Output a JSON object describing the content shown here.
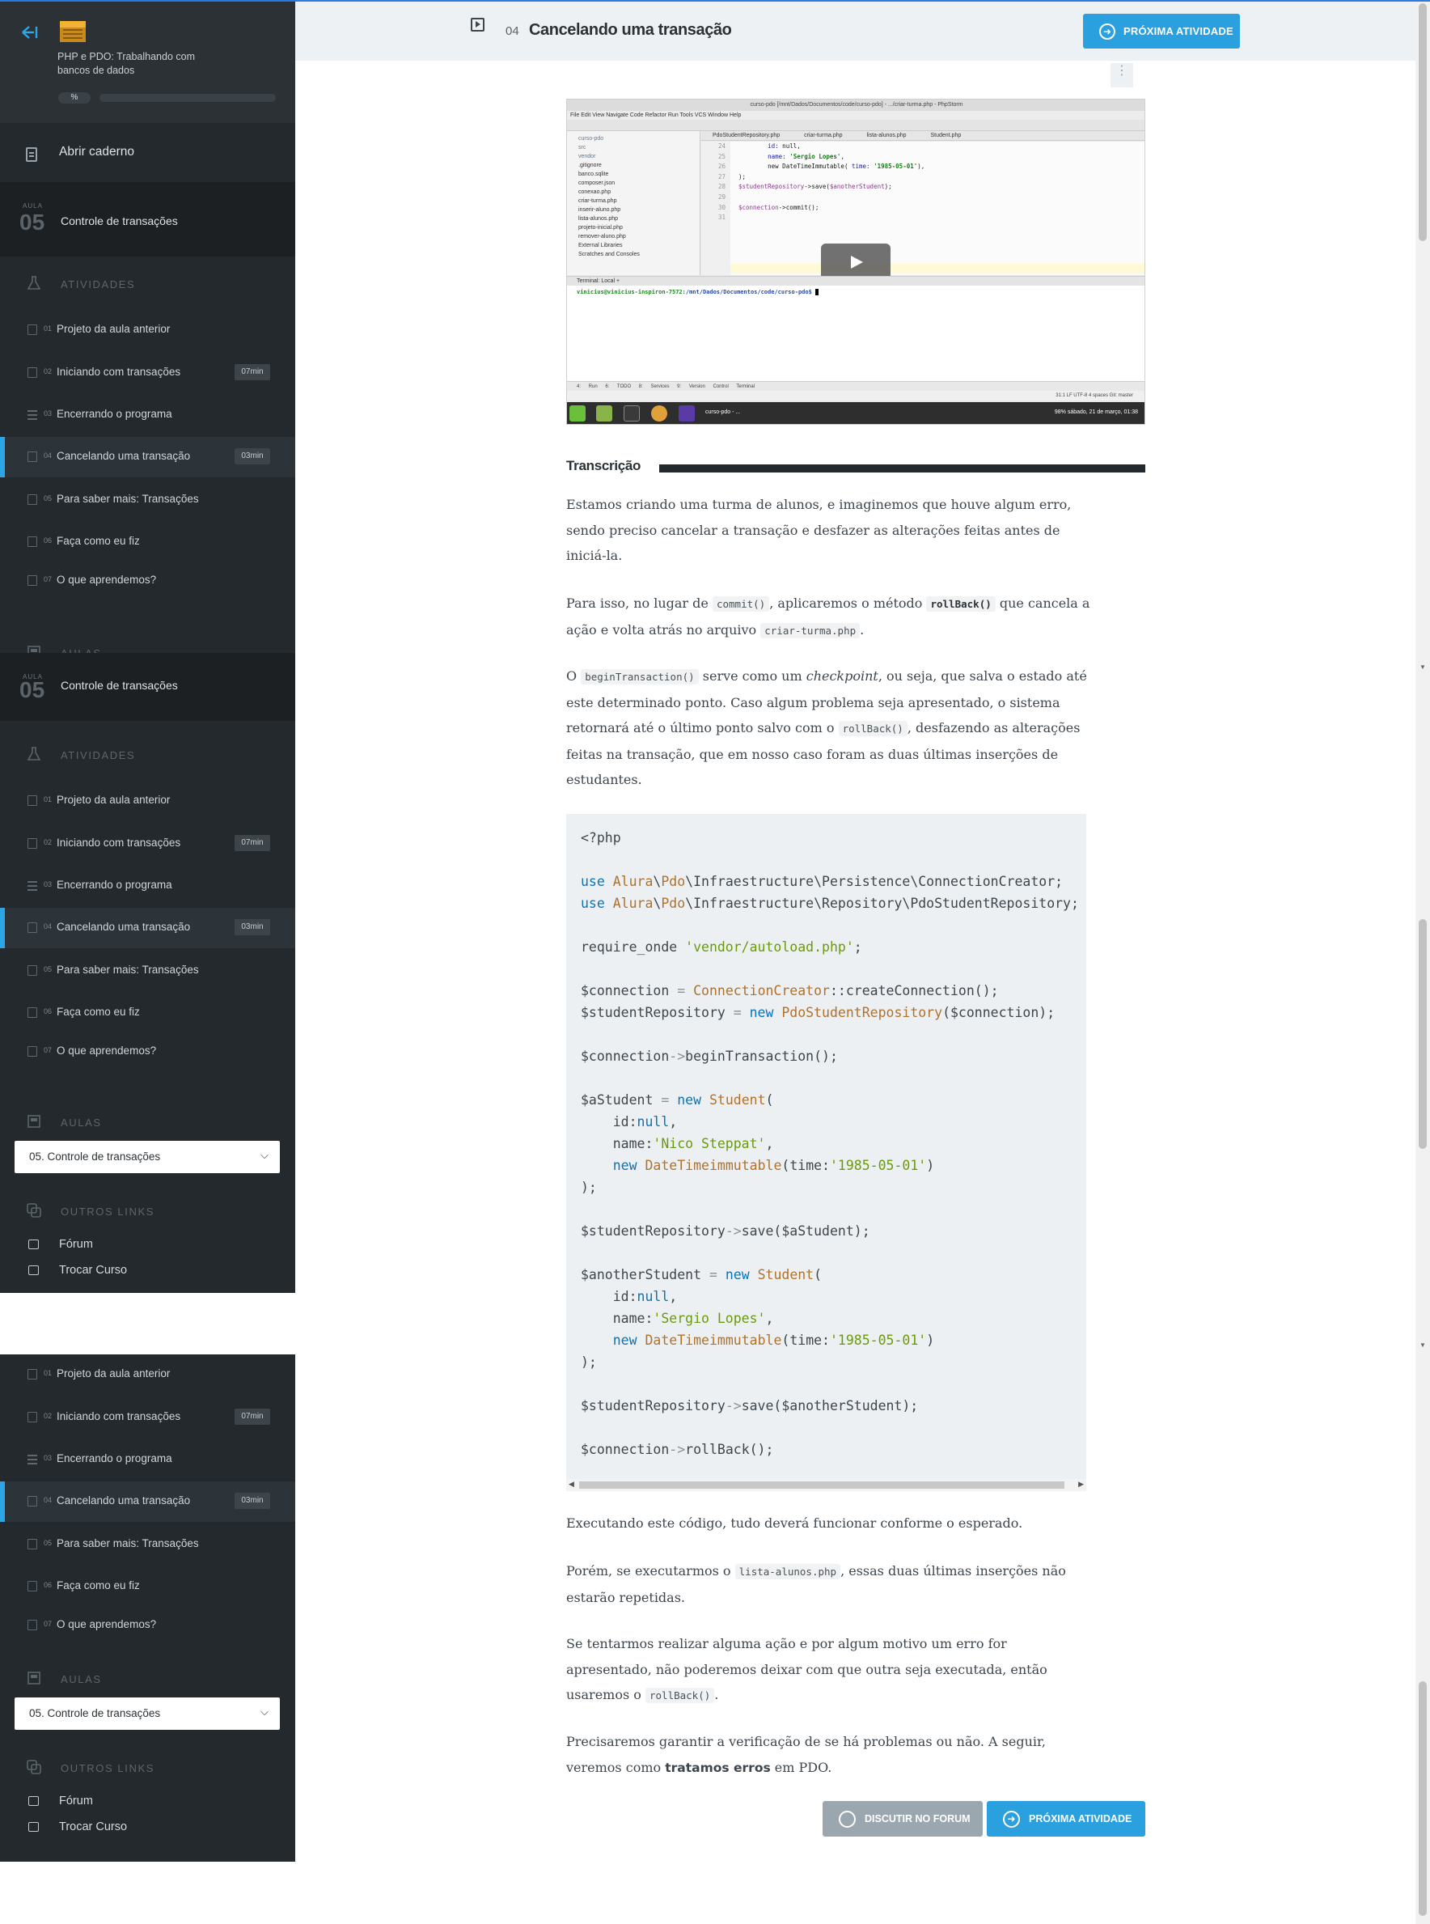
{
  "course": {
    "title": "PHP e PDO: Trabalhando com bancos de dados",
    "progress_label": "%",
    "progress_fraction": 0.0
  },
  "sidebar": {
    "notebook_label": "Abrir caderno",
    "lesson": {
      "aula_label": "AULA",
      "number": "05",
      "title": "Controle de transações"
    },
    "activities_heading": "ATIVIDADES",
    "activities": [
      {
        "num": "01",
        "title": "Projeto da aula anterior",
        "icon": "book-icon",
        "badge": ""
      },
      {
        "num": "02",
        "title": "Iniciando com transações",
        "icon": "video-icon",
        "badge": "07min"
      },
      {
        "num": "03",
        "title": "Encerrando o programa",
        "icon": "list-icon",
        "badge": ""
      },
      {
        "num": "04",
        "title": "Cancelando uma transação",
        "icon": "video-icon",
        "badge": "03min",
        "active": true
      },
      {
        "num": "05",
        "title": "Para saber mais: Transações",
        "icon": "book-icon",
        "badge": ""
      },
      {
        "num": "06",
        "title": "Faça como eu fiz",
        "icon": "book-icon",
        "badge": ""
      },
      {
        "num": "07",
        "title": "O que aprendemos?",
        "icon": "book-icon",
        "badge": ""
      }
    ],
    "aulas_heading": "AULAS",
    "aulas_selected": "05. Controle de transações",
    "outros_heading": "OUTROS LINKS",
    "links": [
      {
        "label": "Fórum",
        "icon": "forum-icon"
      },
      {
        "label": "Trocar Curso",
        "icon": "switch-course-icon"
      }
    ]
  },
  "topbar": {
    "activity_num": "04",
    "activity_title": "Cancelando uma transação",
    "next_label": "PRÓXIMA ATIVIDADE"
  },
  "video": {
    "window_title": "curso-pdo [/mnt/Dados/Documentos/code/curso-pdo] - .../criar-turma.php - PhpStorm",
    "menu": "File  Edit  View  Navigate  Code  Refactor  Run  Tools  VCS  Window  Help",
    "tabs": "PdoStudentRepository.php criar-turma.php lista-alunos.php Student.php",
    "tree": [
      "curso-pdo",
      "src",
      "vendor",
      ".gitignore",
      "banco.sqlite",
      "composer.json",
      "conexao.php",
      "criar-turma.php",
      "inserir-aluno.php",
      "lista-alunos.php",
      "projeto-inicial.php",
      "remover-aluno.php",
      "External Libraries",
      "Scratches and Consoles"
    ],
    "gutter": [
      "24",
      "25",
      "26",
      "27",
      "28",
      "29",
      "30",
      "31"
    ],
    "terminal_header": "Terminal:   Local   +",
    "terminal_user": "vinicius@vinicius-inspiron-7572",
    "terminal_path": ":/mnt/Dados/Documentos/code/curso-pdo$",
    "statusbar": "4: Run   6: TODO   8: Services   9: Version Control   Terminal",
    "status2": "31:1   LF   UTF-8   4 spaces   Git: master",
    "taskbar_label": "curso-pdo - ...",
    "clock": "98%  sábado, 21 de março, 01:38"
  },
  "transcript": {
    "heading": "Transcrição"
  },
  "paragraphs": {
    "p1": "Estamos criando uma turma de alunos, e imaginemos que houve algum erro, sendo preciso cancelar a transação e desfazer as alterações feitas antes de iniciá-la.",
    "p2a": "Para isso, no lugar de ",
    "p2_code1": "commit()",
    "p2b": ", aplicaremos o método ",
    "p2_code2": "rollBack()",
    "p2c": " que cancela a ação e volta atrás no arquivo ",
    "p2_code3": "criar-turma.php",
    "p2d": ".",
    "p3a": "O ",
    "p3_code1": "beginTransaction()",
    "p3b": " serve como um ",
    "p3_em": "checkpoint",
    "p3c": ", ou seja, que salva o estado até este determinado ponto. Caso algum problema seja apresentado, o sistema retornará até o último ponto salvo com o ",
    "p3_code2": "rollBack()",
    "p3d": ", desfazendo as alterações feitas na transação, que em nosso caso foram as duas últimas inserções de estudantes.",
    "p4": "Executando este código, tudo deverá funcionar conforme o esperado.",
    "p5a": "Porém, se executarmos o ",
    "p5_code": "lista-alunos.php",
    "p5b": ", essas duas últimas inserções não estarão repetidas.",
    "p6a": "Se tentarmos realizar alguma ação e por algum motivo um erro for apresentado, não poderemos deixar com que outra seja executada, então usaremos o ",
    "p6_code": "rollBack()",
    "p6b": ".",
    "p7a": "Precisaremos garantir a verificação de se há problemas ou não. A seguir, veremos como ",
    "p7_bold": "tratamos erros",
    "p7b": " em PDO."
  },
  "buttons": {
    "forum": "DISCUTIR NO FORUM",
    "next": "PRÓXIMA ATIVIDADE"
  }
}
